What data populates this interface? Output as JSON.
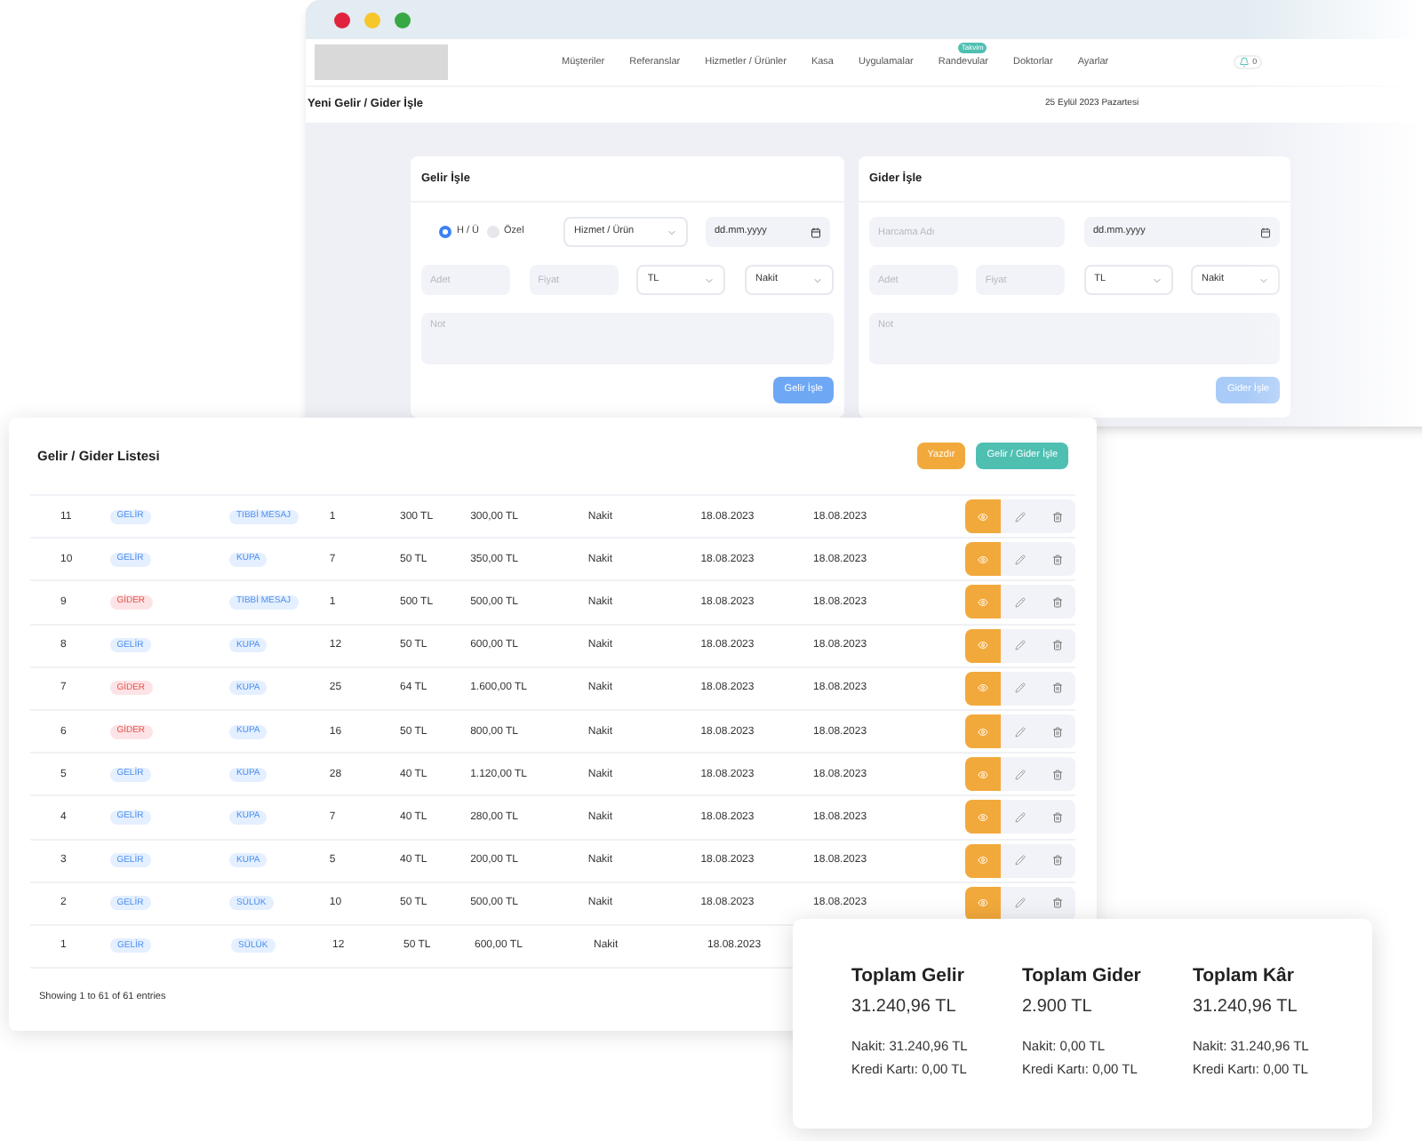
{
  "window": {
    "nav": [
      {
        "label": "Müşteriler"
      },
      {
        "label": "Referanslar"
      },
      {
        "label": "Hizmetler / Ürünler"
      },
      {
        "label": "Kasa"
      },
      {
        "label": "Uygulamalar"
      },
      {
        "label": "Randevular",
        "badge": "Takvim"
      },
      {
        "label": "Doktorlar"
      },
      {
        "label": "Ayarlar"
      }
    ],
    "bell_count": "0",
    "page_title": "Yeni Gelir / Gider İşle",
    "date": "25 Eylül 2023 Pazartesi"
  },
  "gelir_form": {
    "title": "Gelir İşle",
    "radios": [
      {
        "label": "H / Ü",
        "selected": true
      },
      {
        "label": "Özel",
        "selected": false
      }
    ],
    "service": "Hizmet / Ürün",
    "date": "dd.mm.yyyy",
    "qty_placeholder": "Adet",
    "price_placeholder": "Fiyat",
    "currency": "TL",
    "payment": "Nakit",
    "note_placeholder": "Not",
    "submit": "Gelir İşle"
  },
  "gider_form": {
    "title": "Gider İşle",
    "name_placeholder": "Harcama Adı",
    "date": "dd.mm.yyyy",
    "qty_placeholder": "Adet",
    "price_placeholder": "Fiyat",
    "currency": "TL",
    "payment": "Nakit",
    "note_placeholder": "Not",
    "submit": "Gider İşle"
  },
  "list": {
    "title": "Gelir / Gider Listesi",
    "buttons": [
      {
        "label": "Yazdır",
        "kind": "print"
      },
      {
        "label": "Gelir / Gider İşle",
        "kind": "add"
      }
    ],
    "rows": [
      {
        "no": "11",
        "type": {
          "label": "GELİR",
          "kind": "income"
        },
        "category": "TIBBİ MESAJ",
        "qty": "1",
        "price": "300 TL",
        "total": "300,00 TL",
        "payment": "Nakit",
        "date1": "18.08.2023",
        "date2": "18.08.2023",
        "actions": true
      },
      {
        "no": "10",
        "type": {
          "label": "GELİR",
          "kind": "income"
        },
        "category": "KUPA",
        "qty": "7",
        "price": "50 TL",
        "total": "350,00 TL",
        "payment": "Nakit",
        "date1": "18.08.2023",
        "date2": "18.08.2023",
        "actions": true
      },
      {
        "no": "9",
        "type": {
          "label": "GİDER",
          "kind": "expense"
        },
        "category": "TIBBİ MESAJ",
        "qty": "1",
        "price": "500 TL",
        "total": "500,00 TL",
        "payment": "Nakit",
        "date1": "18.08.2023",
        "date2": "18.08.2023",
        "actions": true
      },
      {
        "no": "8",
        "type": {
          "label": "GELİR",
          "kind": "income"
        },
        "category": "KUPA",
        "qty": "12",
        "price": "50 TL",
        "total": "600,00 TL",
        "payment": "Nakit",
        "date1": "18.08.2023",
        "date2": "18.08.2023",
        "actions": true
      },
      {
        "no": "7",
        "type": {
          "label": "GİDER",
          "kind": "expense"
        },
        "category": "KUPA",
        "qty": "25",
        "price": "64 TL",
        "total": "1.600,00 TL",
        "payment": "Nakit",
        "date1": "18.08.2023",
        "date2": "18.08.2023",
        "actions": true
      },
      {
        "no": "6",
        "type": {
          "label": "GİDER",
          "kind": "expense"
        },
        "category": "KUPA",
        "qty": "16",
        "price": "50 TL",
        "total": "800,00 TL",
        "payment": "Nakit",
        "date1": "18.08.2023",
        "date2": "18.08.2023",
        "actions": true
      },
      {
        "no": "5",
        "type": {
          "label": "GELİR",
          "kind": "income"
        },
        "category": "KUPA",
        "qty": "28",
        "price": "40 TL",
        "total": "1.120,00 TL",
        "payment": "Nakit",
        "date1": "18.08.2023",
        "date2": "18.08.2023",
        "actions": true
      },
      {
        "no": "4",
        "type": {
          "label": "GELİR",
          "kind": "income"
        },
        "category": "KUPA",
        "qty": "7",
        "price": "40 TL",
        "total": "280,00 TL",
        "payment": "Nakit",
        "date1": "18.08.2023",
        "date2": "18.08.2023",
        "actions": true
      },
      {
        "no": "3",
        "type": {
          "label": "GELİR",
          "kind": "income"
        },
        "category": "KUPA",
        "qty": "5",
        "price": "40 TL",
        "total": "200,00 TL",
        "payment": "Nakit",
        "date1": "18.08.2023",
        "date2": "18.08.2023",
        "actions": true
      },
      {
        "no": "2",
        "type": {
          "label": "GELİR",
          "kind": "income"
        },
        "category": "SÜLÜK",
        "qty": "10",
        "price": "50 TL",
        "total": "500,00 TL",
        "payment": "Nakit",
        "date1": "18.08.2023",
        "date2": "18.08.2023",
        "actions": true
      },
      {
        "no": "1",
        "type": {
          "label": "GELİR",
          "kind": "income"
        },
        "category": "SÜLÜK",
        "qty": "12",
        "price": "50 TL",
        "total": "600,00 TL",
        "payment": "Nakit",
        "date1": "18.08.2023",
        "actions": false
      }
    ],
    "footer": "Showing 1 to 61 of 61 entries"
  },
  "totals": [
    {
      "title": "Toplam Gelir",
      "amount": "31.240,96 TL",
      "cash": "Nakit: 31.240,96 TL",
      "card": "Kredi Kartı: 0,00 TL"
    },
    {
      "title": "Toplam Gider",
      "amount": "2.900 TL",
      "cash": "Nakit: 0,00 TL",
      "card": "Kredi Kartı: 0,00 TL"
    },
    {
      "title": "Toplam Kâr",
      "amount": "31.240,96 TL",
      "cash": "Nakit: 31.240,96 TL",
      "card": "Kredi Kartı: 0,00 TL"
    }
  ]
}
